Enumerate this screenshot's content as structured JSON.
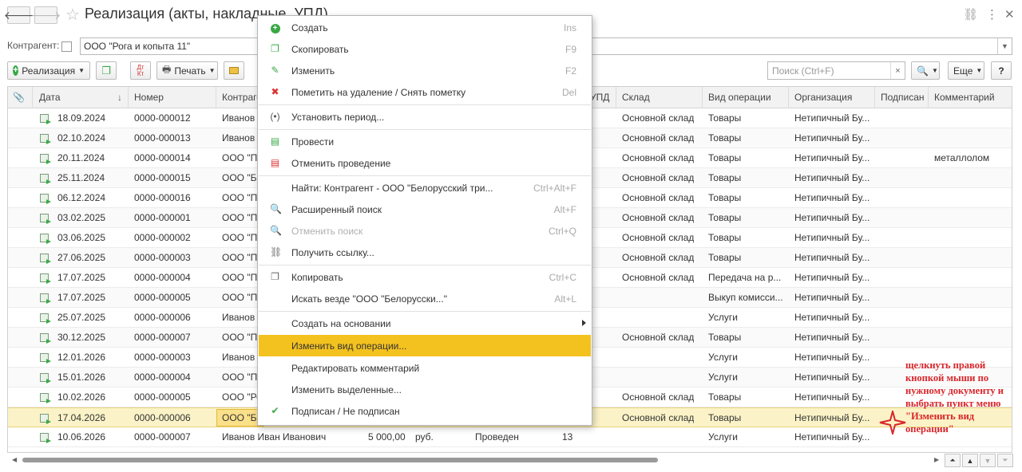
{
  "title": "Реализация (акты, накладные, УПД)",
  "filter": {
    "label": "Контрагент:",
    "value": "ООО \"Рога и копыта 11\""
  },
  "toolbar": {
    "realization": "Реализация",
    "print": "Печать",
    "search_placeholder": "Поиск (Ctrl+F)",
    "more": "Еще",
    "help": "?"
  },
  "columns": [
    "Дата",
    "Номер",
    "Контрагент",
    "УПД",
    "Склад",
    "Вид операции",
    "Организация",
    "Подписан",
    "Комментарий"
  ],
  "rows": [
    {
      "date": "18.09.2024",
      "num": "0000-000012",
      "kontr": "Иванов",
      "sklad": "Основной склад",
      "vid": "Товары",
      "org": "Нетипичный Бу...",
      "comment": ""
    },
    {
      "date": "02.10.2024",
      "num": "0000-000013",
      "kontr": "Иванов",
      "sklad": "Основной склад",
      "vid": "Товары",
      "org": "Нетипичный Бу...",
      "comment": ""
    },
    {
      "date": "20.11.2024",
      "num": "0000-000014",
      "kontr": "ООО \"По",
      "sklad": "Основной склад",
      "vid": "Товары",
      "org": "Нетипичный Бу...",
      "comment": "металлолом"
    },
    {
      "date": "25.11.2024",
      "num": "0000-000015",
      "kontr": "ООО \"Бе",
      "sklad": "Основной склад",
      "vid": "Товары",
      "org": "Нетипичный Бу...",
      "comment": ""
    },
    {
      "date": "06.12.2024",
      "num": "0000-000016",
      "kontr": "ООО \"По",
      "sklad": "Основной склад",
      "vid": "Товары",
      "org": "Нетипичный Бу...",
      "comment": ""
    },
    {
      "date": "03.02.2025",
      "num": "0000-000001",
      "kontr": "ООО \"По",
      "sklad": "Основной склад",
      "vid": "Товары",
      "org": "Нетипичный Бу...",
      "comment": ""
    },
    {
      "date": "03.06.2025",
      "num": "0000-000002",
      "kontr": "ООО \"По",
      "sklad": "Основной склад",
      "vid": "Товары",
      "org": "Нетипичный Бу...",
      "comment": ""
    },
    {
      "date": "27.06.2025",
      "num": "0000-000003",
      "kontr": "ООО \"По",
      "sklad": "Основной склад",
      "vid": "Товары",
      "org": "Нетипичный Бу...",
      "comment": ""
    },
    {
      "date": "17.07.2025",
      "num": "0000-000004",
      "kontr": "ООО \"По",
      "sklad": "Основной склад",
      "vid": "Передача на р...",
      "org": "Нетипичный Бу...",
      "comment": ""
    },
    {
      "date": "17.07.2025",
      "num": "0000-000005",
      "kontr": "ООО \"По",
      "sklad": "",
      "vid": "Выкуп комисси...",
      "org": "Нетипичный Бу...",
      "comment": ""
    },
    {
      "date": "25.07.2025",
      "num": "0000-000006",
      "kontr": "Иванов",
      "sklad": "",
      "vid": "Услуги",
      "org": "Нетипичный Бу...",
      "comment": ""
    },
    {
      "date": "30.12.2025",
      "num": "0000-000007",
      "kontr": "ООО \"По",
      "sklad": "Основной склад",
      "vid": "Товары",
      "org": "Нетипичный Бу...",
      "comment": ""
    },
    {
      "date": "12.01.2026",
      "num": "0000-000003",
      "kontr": "Иванов",
      "sklad": "",
      "vid": "Услуги",
      "org": "Нетипичный Бу...",
      "comment": ""
    },
    {
      "date": "15.01.2026",
      "num": "0000-000004",
      "kontr": "ООО \"По",
      "sklad": "",
      "vid": "Услуги",
      "org": "Нетипичный Бу...",
      "comment": ""
    },
    {
      "date": "10.02.2026",
      "num": "0000-000005",
      "kontr": "ООО \"Ро",
      "sklad": "Основной склад",
      "vid": "Товары",
      "org": "Нетипичный Бу...",
      "comment": ""
    },
    {
      "date": "17.04.2026",
      "num": "0000-000006",
      "kontr": "ООО \"Бе",
      "sklad": "Основной склад",
      "vid": "Товары",
      "org": "Нетипичный Бу...",
      "comment": ""
    },
    {
      "date": "10.06.2026",
      "num": "0000-000007",
      "kontr": "Иванов Иван Иванович",
      "sum": "5 000,00",
      "cur": "руб.",
      "status": "Проведен",
      "upd": "13",
      "sklad": "",
      "vid": "Услуги",
      "org": "Нетипичный Бу...",
      "comment": ""
    }
  ],
  "menu": [
    {
      "label": "Создать",
      "key": "Ins"
    },
    {
      "label": "Скопировать",
      "key": "F9"
    },
    {
      "label": "Изменить",
      "key": "F2"
    },
    {
      "label": "Пометить на удаление / Снять пометку",
      "key": "Del"
    },
    {
      "label": "Установить период...",
      "key": ""
    },
    {
      "label": "Провести",
      "key": ""
    },
    {
      "label": "Отменить проведение",
      "key": ""
    },
    {
      "label": "Найти: Контрагент - ООО \"Белорусский три...",
      "key": "Ctrl+Alt+F"
    },
    {
      "label": "Расширенный поиск",
      "key": "Alt+F"
    },
    {
      "label": "Отменить поиск",
      "key": "Ctrl+Q"
    },
    {
      "label": "Получить ссылку...",
      "key": ""
    },
    {
      "label": "Копировать",
      "key": "Ctrl+C"
    },
    {
      "label": "Искать везде \"ООО \"Белорусски...\"",
      "key": "Alt+L"
    },
    {
      "label": "Создать на основании",
      "key": ""
    },
    {
      "label": "Изменить вид операции...",
      "key": ""
    },
    {
      "label": "Редактировать комментарий",
      "key": ""
    },
    {
      "label": "Изменить выделенные...",
      "key": ""
    },
    {
      "label": "Подписан / Не подписан",
      "key": ""
    }
  ],
  "annotation": "щелкнуть правой кнопкой мыши по нужному документу и выбрать пункт меню \"Изменить вид операции\"",
  "colors": {
    "highlight": "#f4c21f",
    "selected_row": "#fbf3c7",
    "annotation": "#d9252a"
  }
}
